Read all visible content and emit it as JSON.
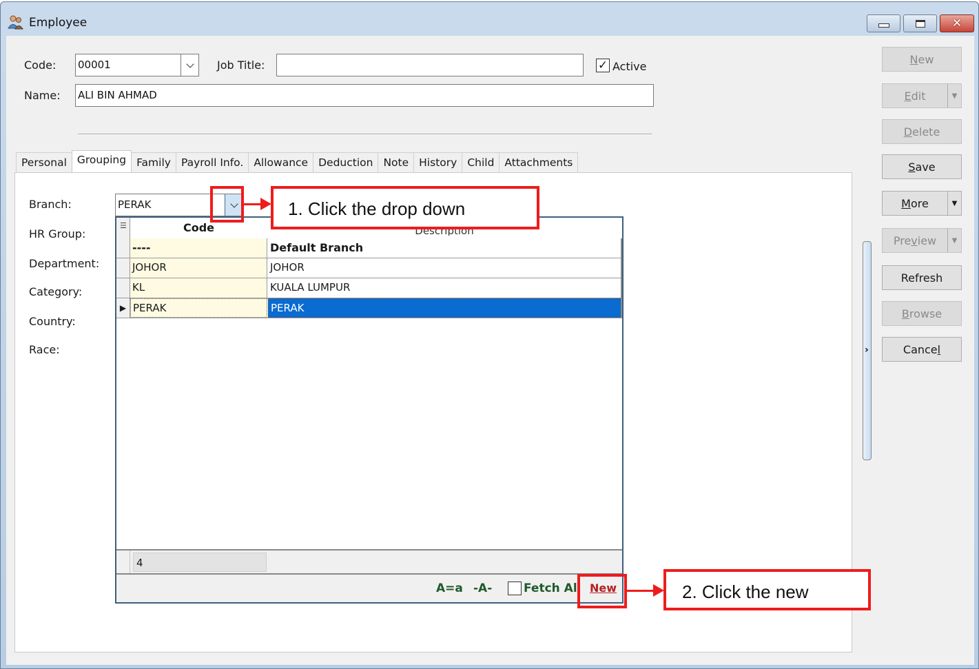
{
  "window": {
    "title": "Employee",
    "icon": "employees-icon",
    "controls": {
      "minimize": "minimize-icon",
      "maximize": "maximize-icon",
      "close": "close-icon"
    }
  },
  "header": {
    "code_label": "Code:",
    "code_value": "00001",
    "job_title_label": "Job Title:",
    "job_title_value": "",
    "active_label": "Active",
    "active_checked": true,
    "name_label": "Name:",
    "name_value": "ALI BIN AHMAD"
  },
  "tabs": [
    {
      "label": "Personal",
      "active": false
    },
    {
      "label": "Grouping",
      "active": true
    },
    {
      "label": "Family",
      "active": false
    },
    {
      "label": "Payroll Info.",
      "active": false
    },
    {
      "label": "Allowance",
      "active": false
    },
    {
      "label": "Deduction",
      "active": false
    },
    {
      "label": "Note",
      "active": false
    },
    {
      "label": "History",
      "active": false
    },
    {
      "label": "Child",
      "active": false
    },
    {
      "label": "Attachments",
      "active": false
    }
  ],
  "grouping": {
    "labels": [
      "Branch:",
      "HR Group:",
      "Department:",
      "Category:",
      "Country:",
      "Race:"
    ],
    "branch_value": "PERAK"
  },
  "dropdown": {
    "columns": [
      "Code",
      "Description"
    ],
    "rows": [
      {
        "code": "----",
        "description": "Default Branch",
        "selected": false
      },
      {
        "code": "JOHOR",
        "description": "JOHOR",
        "selected": false
      },
      {
        "code": "KL",
        "description": "KUALA LUMPUR",
        "selected": false
      },
      {
        "code": "PERAK",
        "description": "PERAK",
        "selected": true
      }
    ],
    "record_count": "4",
    "toolbar": {
      "case_toggle": "A=a",
      "partial_match": "-A-",
      "fetch_all_label": "Fetch All",
      "fetch_all_checked": false,
      "new_label": "New"
    }
  },
  "side_buttons": [
    {
      "label": "New",
      "underline": "N",
      "disabled": true,
      "split": false
    },
    {
      "label": "Edit",
      "underline": "E",
      "disabled": true,
      "split": true
    },
    {
      "label": "Delete",
      "underline": "D",
      "disabled": true,
      "split": false
    },
    {
      "label": "Save",
      "underline": "S",
      "disabled": false,
      "split": false
    },
    {
      "label": "More",
      "underline": "M",
      "disabled": false,
      "split": true
    },
    {
      "label": "Preview",
      "underline": "v",
      "disabled": true,
      "split": true
    },
    {
      "label": "Refresh",
      "underline": "",
      "disabled": false,
      "split": false
    },
    {
      "label": "Browse",
      "underline": "B",
      "disabled": true,
      "split": false
    },
    {
      "label": "Cancel",
      "underline": "l",
      "disabled": false,
      "split": false
    }
  ],
  "annotations": {
    "step1": "1. Click the drop down",
    "step2": "2. Click the new",
    "color": "#ee1c1c"
  }
}
